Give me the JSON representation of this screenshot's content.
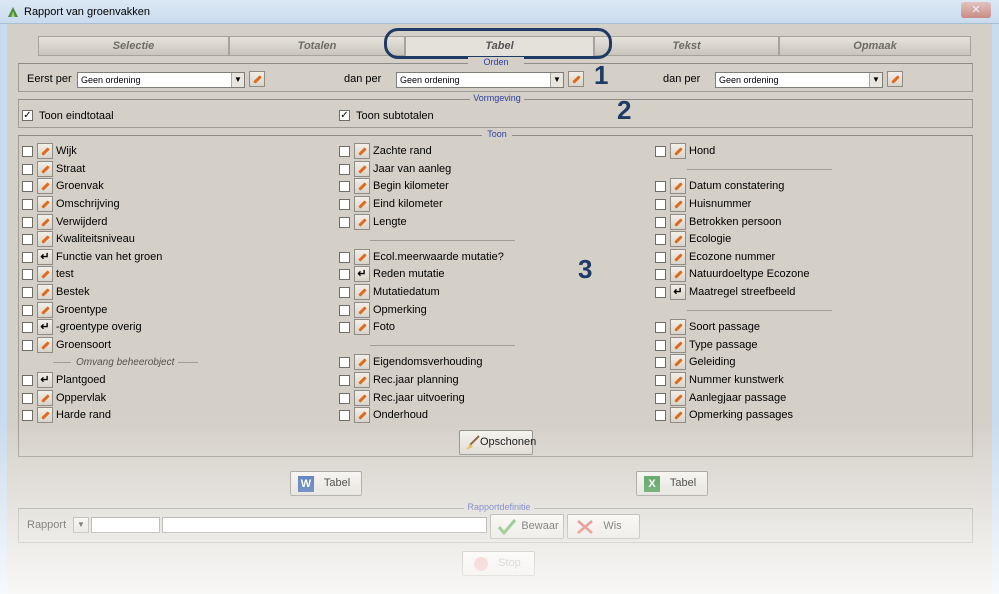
{
  "window": {
    "title": "Rapport van groenvakken",
    "close_glyph": "✕"
  },
  "tabs": [
    {
      "label": "Selectie"
    },
    {
      "label": "Totalen"
    },
    {
      "label": "Tabel"
    },
    {
      "label": "Tekst"
    },
    {
      "label": "Opmaak"
    }
  ],
  "annotations": {
    "one": "1",
    "two": "2",
    "three": "3"
  },
  "orden": {
    "title": "Orden",
    "label1": "Eerst per",
    "label2": "dan per",
    "label3": "dan per",
    "value1": "Geen ordening",
    "value2": "Geen ordening",
    "value3": "Geen ordening"
  },
  "vormgeving": {
    "title": "Vormgeving",
    "eindtotaal": "Toon eindtotaal",
    "subtotalen": "Toon subtotalen",
    "eindtotaal_checked": true,
    "subtotalen_checked": true
  },
  "toon": {
    "title": "Toon",
    "col1": [
      "Wijk",
      "Straat",
      "Groenvak",
      "Omschrijving",
      "Verwijderd",
      "Kwaliteitsniveau",
      "Functie van het groen",
      "test",
      "Bestek",
      "Groentype",
      "-groentype overig",
      "Groensoort",
      "Plantgoed",
      "Oppervlak",
      "Harde rand"
    ],
    "col1_section": "Omvang beheerobject",
    "col2": [
      "Zachte rand",
      "Jaar van aanleg",
      "Begin kilometer",
      "Eind kilometer",
      "Lengte",
      "Ecol.meerwaarde mutatie?",
      "Reden mutatie",
      "Mutatiedatum",
      "Opmerking",
      "Foto",
      "Eigendomsverhouding",
      "Rec.jaar planning",
      "Rec.jaar uitvoering",
      "Onderhoud"
    ],
    "col3": [
      "Hond",
      "Datum constatering",
      "Huisnummer",
      "Betrokken persoon",
      "Ecologie",
      "Ecozone nummer",
      "Natuurdoeltype Ecozone",
      "Maatregel streefbeeld",
      "Soort passage",
      "Type passage",
      "Geleiding",
      "Nummer kunstwerk",
      "Aanlegjaar passage",
      "Opmerking passages"
    ],
    "opschonen": "Opschonen"
  },
  "export": {
    "word": "Tabel",
    "excel": "Tabel"
  },
  "rapportdefinitie": {
    "title": "Rapportdefinitie",
    "label": "Rapport",
    "bewaar": "Bewaar",
    "wis": "Wis",
    "stop": "Stop"
  },
  "colors": {
    "accent": "#1e3a66",
    "group_title": "#2c3ea6",
    "panel": "#d4d0c8"
  }
}
